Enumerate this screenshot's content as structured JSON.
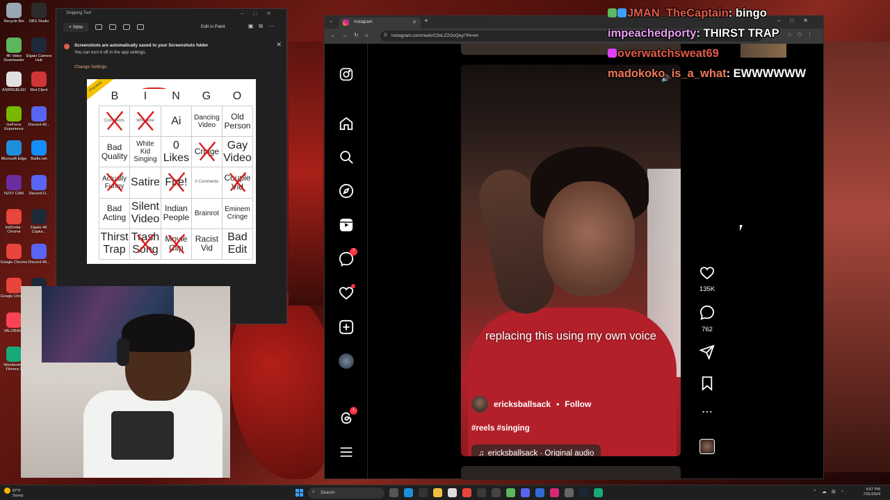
{
  "desktop": {
    "icons": [
      {
        "label": "Recycle Bin",
        "color": "#9aa6b2"
      },
      {
        "label": "OBS Studio",
        "color": "#2b2b2b"
      },
      {
        "label": "4K Video Downloader",
        "color": "#5cb85c"
      },
      {
        "label": "Elgato Camera Hub",
        "color": "#1e2a3a"
      },
      {
        "label": "ASRRGBLED",
        "color": "#e0e0e0"
      },
      {
        "label": "Riot Client",
        "color": "#d13639"
      },
      {
        "label": "GeForce Experience",
        "color": "#76b900"
      },
      {
        "label": "Discord-40...",
        "color": "#5865f2"
      },
      {
        "label": "Microsoft Edge",
        "color": "#1f8fd9"
      },
      {
        "label": "Battle.net",
        "color": "#148eff"
      },
      {
        "label": "NZXT CAM",
        "color": "#6b2d9e"
      },
      {
        "label": "Discord-D...",
        "color": "#5865f2"
      },
      {
        "label": "ImDontai - Chrome",
        "color": "#e8453c"
      },
      {
        "label": "Elgato 4K Captur...",
        "color": "#1e2a3a"
      },
      {
        "label": "Google Chrome",
        "color": "#e8453c"
      },
      {
        "label": "Discord-40...",
        "color": "#5865f2"
      },
      {
        "label": "Google Chrome",
        "color": "#e8453c"
      },
      {
        "label": "Steam",
        "color": "#1b2838"
      },
      {
        "label": "VALORANT",
        "color": "#fa4454"
      },
      {
        "label": "Call of Duty®...",
        "color": "#222"
      },
      {
        "label": "Wondersh... Filmora 1",
        "color": "#18a87a"
      },
      {
        "label": "Stream De...",
        "color": "#1a1a1a"
      }
    ]
  },
  "snipping_tool": {
    "title": "Snipping Tool",
    "new_label": "New",
    "edit_in_paint": "Edit in Paint",
    "notice_title": "Screenshots are automatically saved to your Screenshots folder",
    "notice_body": "You can turn it off in the app settings.",
    "change_settings": "Change Settings"
  },
  "bingo": {
    "ribbon": "Preview",
    "header": [
      "B",
      "I",
      "N",
      "G",
      "O"
    ],
    "cells": [
      {
        "text": "Comments",
        "size": "small",
        "crossed": true
      },
      {
        "text": "Whe ame",
        "size": "small",
        "crossed": true
      },
      {
        "text": "Ai",
        "size": "big",
        "crossed": false
      },
      {
        "text": "Dancing Video",
        "size": "mid",
        "crossed": false
      },
      {
        "text": "Old Person",
        "size": "",
        "crossed": false
      },
      {
        "text": "Bad Quality",
        "size": "",
        "crossed": false
      },
      {
        "text": "White Kid Singing",
        "size": "mid",
        "crossed": false
      },
      {
        "text": "0 Likes",
        "size": "big",
        "crossed": false
      },
      {
        "text": "Cringe",
        "size": "",
        "crossed": true
      },
      {
        "text": "Gay Video",
        "size": "big",
        "crossed": false
      },
      {
        "text": "Actually Funny",
        "size": "mid",
        "crossed": true
      },
      {
        "text": "Satire",
        "size": "big",
        "crossed": false
      },
      {
        "text": "Fire!",
        "size": "big",
        "crossed": true
      },
      {
        "text": "0 Comments",
        "size": "small",
        "crossed": false
      },
      {
        "text": "Couple Vid",
        "size": "",
        "crossed": true
      },
      {
        "text": "Bad Acting",
        "size": "",
        "crossed": false
      },
      {
        "text": "Silent Video",
        "size": "big",
        "crossed": false
      },
      {
        "text": "Indian People",
        "size": "",
        "crossed": false
      },
      {
        "text": "Brainrot",
        "size": "mid",
        "crossed": false
      },
      {
        "text": "Eminem Cringe",
        "size": "mid",
        "crossed": false
      },
      {
        "text": "Thirst Trap",
        "size": "big",
        "crossed": false
      },
      {
        "text": "Trash Song",
        "size": "big",
        "crossed": true
      },
      {
        "text": "Movie Clip",
        "size": "",
        "crossed": true
      },
      {
        "text": "Racist Vid",
        "size": "",
        "crossed": false
      },
      {
        "text": "Bad Edit",
        "size": "big",
        "crossed": false
      }
    ]
  },
  "browser": {
    "tab_title": "Instagram",
    "url": "instagram.com/reels/C9xLZ2OuQey/?hl=en"
  },
  "instagram": {
    "messages_badge": "7",
    "threads_badge": "1",
    "reel": {
      "caption": "replacing this using my own voice",
      "username": "ericksballsack",
      "dot": "•",
      "follow": "Follow",
      "tags": "#reels #singing",
      "audio": "ericksballsack · Original audio"
    },
    "likes": "135K",
    "comments": "762"
  },
  "chat": [
    {
      "user": "JMAN_TheCaptain",
      "message": "bingo",
      "color": "#e25b4a",
      "badges": [
        "#5cb85c",
        "#3ba0ff"
      ]
    },
    {
      "user": "impeachedporty",
      "message": "THIRST TRAP",
      "color": "#e8a0f0",
      "badges": []
    },
    {
      "user": "overwatchsweat69",
      "message": "",
      "color": "#e25b4a",
      "badges": [
        "#e040fb"
      ]
    },
    {
      "user": "madokoko_is_a_what",
      "message": "EWWWWWW",
      "color": "#f07a5a",
      "badges": []
    }
  ],
  "taskbar": {
    "temp": "87°F",
    "weather": "Sunny",
    "search": "Search",
    "time": "9:57 PM",
    "date": "7/31/2024"
  }
}
